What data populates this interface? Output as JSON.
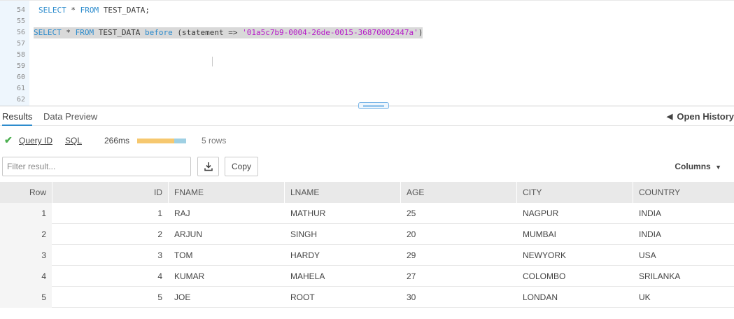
{
  "editor": {
    "lines": [
      {
        "num": "54",
        "segments": [
          {
            "t": "SELECT",
            "c": "kw"
          },
          {
            "t": " * ",
            "c": ""
          },
          {
            "t": "FROM",
            "c": "kw"
          },
          {
            "t": " TEST_DATA;",
            "c": ""
          }
        ]
      },
      {
        "num": "55",
        "segments": []
      },
      {
        "num": "56",
        "segments": [
          {
            "t": "SELECT",
            "c": "kw"
          },
          {
            "t": " * ",
            "c": ""
          },
          {
            "t": "FROM",
            "c": "kw"
          },
          {
            "t": " TEST_DATA ",
            "c": ""
          },
          {
            "t": "before",
            "c": "kw2"
          },
          {
            "t": " (statement => ",
            "c": ""
          },
          {
            "t": "'01a5c7b9-0004-26de-0015-36870002447a'",
            "c": "str"
          },
          {
            "t": ")",
            "c": ""
          }
        ]
      },
      {
        "num": "57",
        "segments": []
      },
      {
        "num": "58",
        "segments": []
      },
      {
        "num": "59",
        "segments": []
      },
      {
        "num": "60",
        "segments": []
      },
      {
        "num": "61",
        "segments": []
      },
      {
        "num": "62",
        "segments": []
      }
    ]
  },
  "tabs": {
    "results": "Results",
    "data_preview": "Data Preview",
    "open_history": "Open History"
  },
  "meta": {
    "query_id": "Query ID",
    "sql": "SQL",
    "duration": "266ms",
    "duration_fill_fraction": 0.75,
    "rows": "5 rows"
  },
  "toolbar": {
    "filter_placeholder": "Filter result...",
    "download_icon": "download-icon",
    "copy_label": "Copy",
    "columns_label": "Columns"
  },
  "grid": {
    "headers": [
      "Row",
      "ID",
      "FNAME",
      "LNAME",
      "AGE",
      "CITY",
      "COUNTRY"
    ],
    "rows": [
      [
        "1",
        "1",
        "RAJ",
        "MATHUR",
        "25",
        "NAGPUR",
        "INDIA"
      ],
      [
        "2",
        "2",
        "ARJUN",
        "SINGH",
        "20",
        "MUMBAI",
        "INDIA"
      ],
      [
        "3",
        "3",
        "TOM",
        "HARDY",
        "29",
        "NEWYORK",
        "USA"
      ],
      [
        "4",
        "4",
        "KUMAR",
        "MAHELA",
        "27",
        "COLOMBO",
        "SRILANKA"
      ],
      [
        "5",
        "5",
        "JOE",
        "ROOT",
        "30",
        "LONDAN",
        "UK"
      ]
    ]
  },
  "colors": {
    "accent": "#2d8ccd",
    "string": "#b71cc9",
    "success": "#4caf50"
  }
}
